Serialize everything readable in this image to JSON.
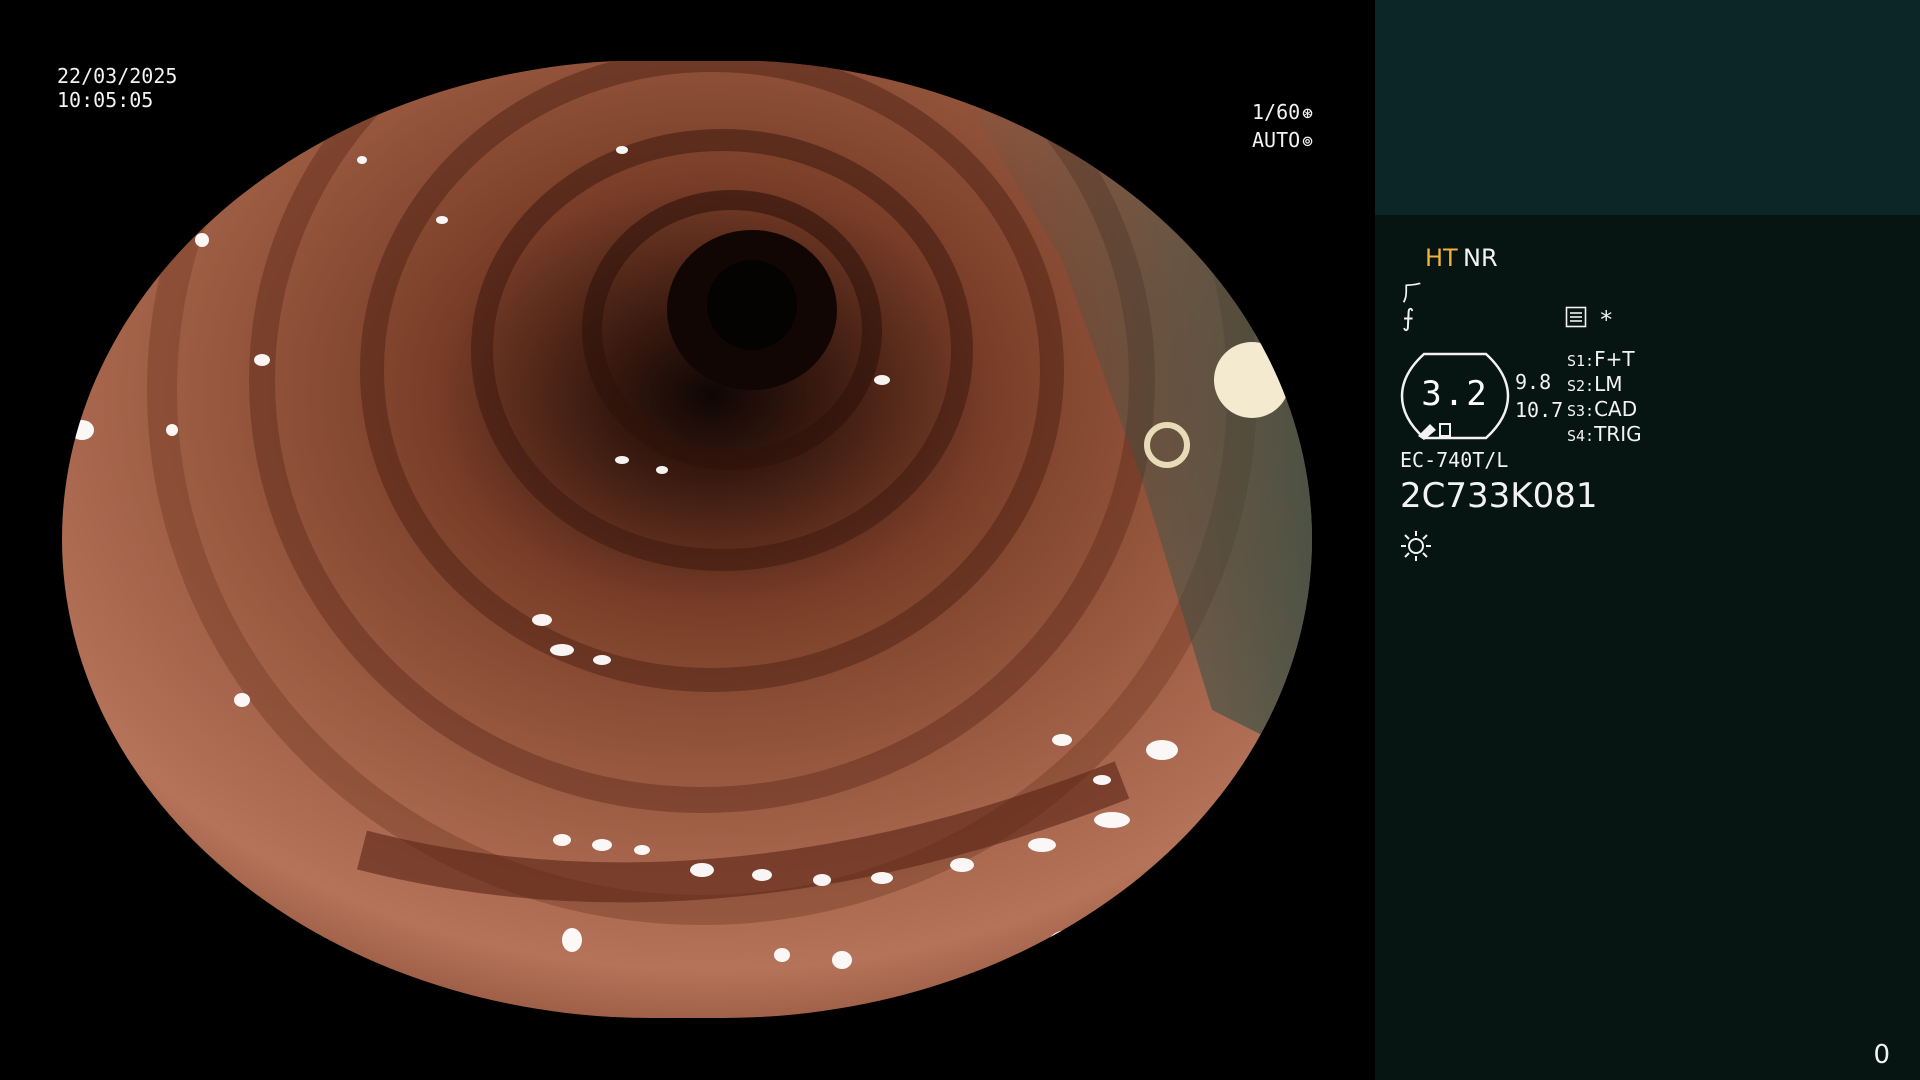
{
  "video": {
    "date": "22/03/2025",
    "time": "10:05:05",
    "shutter": "1/60",
    "shutter_icon": "aperture-icon",
    "exposure_mode": "AUTO",
    "exposure_icon": "iris-icon"
  },
  "panel": {
    "mode_ht": "HT",
    "mode_nr": "NR",
    "symbol_1": "⺁",
    "symbol_2": "⨍",
    "record_icon": "record-list-icon",
    "asterisk": "*",
    "zoom": {
      "value": "3.2",
      "min": "9.8",
      "max": "10.7"
    },
    "switches": [
      {
        "label": "S1:",
        "value": "F+T"
      },
      {
        "label": "S2:",
        "value": "LM"
      },
      {
        "label": "S3:",
        "value": "CAD"
      },
      {
        "label": "S4:",
        "value": "TRIG"
      }
    ],
    "scope_model": "EC-740T/L",
    "scope_serial": "2C733K081",
    "light_icon": "sun-icon",
    "counter": "0"
  },
  "colors": {
    "panel_bg": "#061412",
    "preview_bg": "#0c2526",
    "ht_accent": "#f1b23d",
    "tissue": "#a8624a"
  }
}
